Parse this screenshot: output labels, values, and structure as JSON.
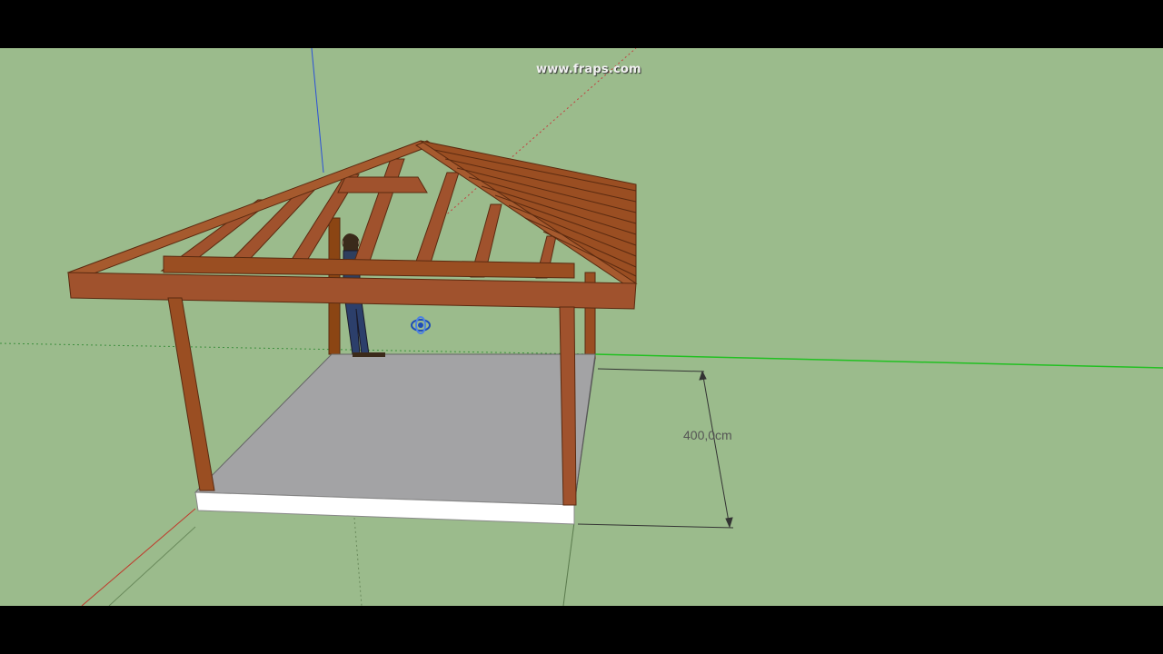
{
  "watermark": {
    "text": "www.fraps.com"
  },
  "dimension": {
    "label": "400,0cm"
  },
  "colors": {
    "ground": "#9bbb8c",
    "wood": "#a0522d",
    "wood_dark": "#6b3418",
    "floor": "#a3a3a5",
    "slab_edge": "#ffffff",
    "axis_green": "#21c021",
    "axis_blue": "#2a50d8",
    "axis_red": "#c0392b"
  },
  "icons": {
    "orbit": "orbit-icon",
    "figure": "human-figure"
  }
}
